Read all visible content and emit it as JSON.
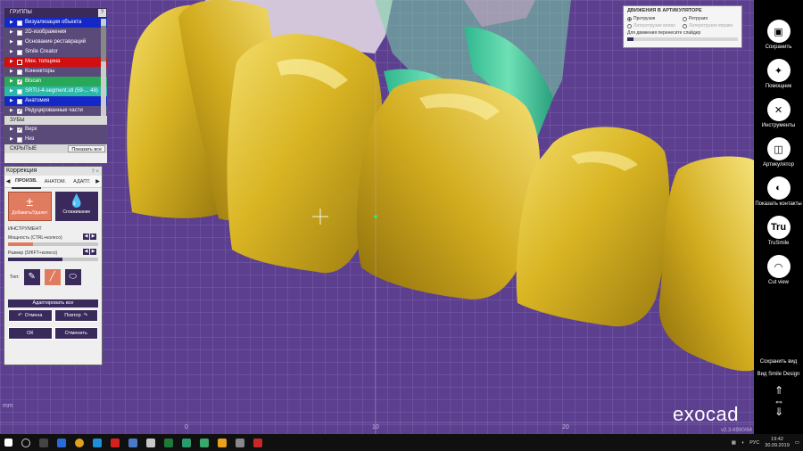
{
  "groups_panel": {
    "title": "ГРУППЫ",
    "help": "?",
    "items": [
      {
        "label": "Визуализация объекта",
        "color": "#1428c8",
        "check": "none"
      },
      {
        "label": "2D-изображения",
        "color": "#5a4a7a",
        "check": "none"
      },
      {
        "label": "Основание реставраций",
        "color": "#5a4a7a",
        "check": "none"
      },
      {
        "label": "Smile Creator",
        "color": "#5a4a7a",
        "check": "none"
      },
      {
        "label": "Мин. толщина",
        "color": "#d01010",
        "check": "red"
      },
      {
        "label": "Коннекторы",
        "color": "#5a4a7a",
        "check": "none"
      },
      {
        "label": "Blscan",
        "color": "#2aa85a",
        "check": "checked"
      },
      {
        "label": "SRTU-4-segment.stl (59-... 48)",
        "color": "#2ab8a8",
        "check": "none"
      },
      {
        "label": "Анатомия",
        "color": "#1428c8",
        "check": "none"
      },
      {
        "label": "Редуцированные части",
        "color": "#5a4a7a",
        "check": "checked"
      }
    ],
    "teeth_header": "ЗУБЫ",
    "teeth": [
      {
        "label": "Верх",
        "check": "checked"
      },
      {
        "label": "Низ",
        "check": "none"
      }
    ],
    "hidden_header": "СКРЫТЫЕ",
    "show_all": "Показать все"
  },
  "correction_panel": {
    "title": "Коррекция",
    "title_btns": "? ×",
    "tabs": [
      "ПРОИЗВ.",
      "АНАТОМ.",
      "АДАПТ."
    ],
    "add_remove": "Добавить/Удалит",
    "smoothing": "Сглаживание",
    "tool_label": "ИНСТРУМЕНТ",
    "strength_label": "Мощность (CTRL+колесо)",
    "strength_value": 0.28,
    "size_label": "Размер (SHIFT+колесо)",
    "size_value": 0.6,
    "type_label": "Тип:",
    "adapt_all": "Адаптировать все",
    "undo": "Отмена",
    "redo": "Повтор",
    "ok": "ОК",
    "cancel": "Отменить"
  },
  "articulator_panel": {
    "title": "ДВИЖЕНИЯ В АРТИКУЛЯТОРЕ",
    "options": [
      {
        "label": "Протрузия",
        "selected": true,
        "enabled": true
      },
      {
        "label": "Ретрузия",
        "selected": false,
        "enabled": true
      },
      {
        "label": "Латеротрузия влево",
        "selected": false,
        "enabled": false
      },
      {
        "label": "Латеротрузия вправо",
        "selected": false,
        "enabled": false
      }
    ],
    "slider_label": "Для движения перенесите слайдер",
    "slider_value": 0
  },
  "right_toolbar": {
    "items": [
      {
        "label": "Сохранить",
        "icon": "save-icon",
        "glyph": "▣"
      },
      {
        "label": "Помощник",
        "icon": "wizard-icon",
        "glyph": "✦"
      },
      {
        "label": "Инструменты",
        "icon": "tools-icon",
        "glyph": "✕"
      },
      {
        "label": "Артикулятор",
        "icon": "articulator-icon",
        "glyph": "◫"
      },
      {
        "label": "Показать контакты",
        "icon": "contacts-icon",
        "glyph": "◐"
      },
      {
        "label": "TruSmile",
        "icon": "trusmile-icon",
        "glyph": "Tru"
      },
      {
        "label": "Cut view",
        "icon": "cut-view-icon",
        "glyph": "◠"
      }
    ],
    "save_view": "Сохранить вид",
    "smile_view": "Вид Smile Design"
  },
  "viewport": {
    "logo": "exocad",
    "version": "v2.3-6990/64",
    "ruler_labels": [
      "mm",
      "0",
      "10",
      "20"
    ]
  },
  "taskbar": {
    "time": "19:42",
    "date": "30.09.2019",
    "lang": "РУС"
  }
}
